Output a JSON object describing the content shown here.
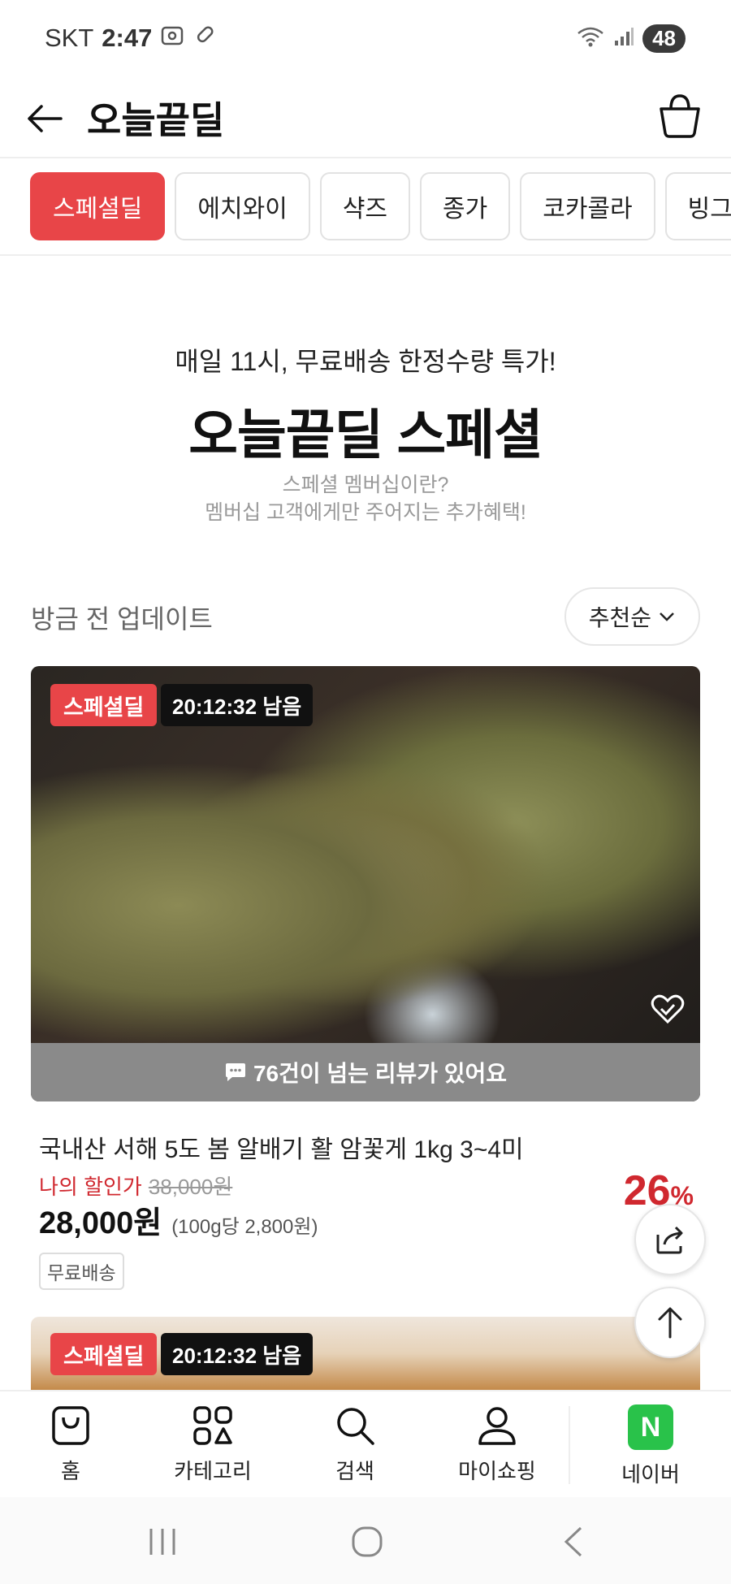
{
  "status_bar": {
    "carrier": "SKT",
    "time": "2:47",
    "battery": "48"
  },
  "header": {
    "title": "오늘끝딜"
  },
  "tabs": [
    {
      "label": "스페셜딜"
    },
    {
      "label": "에치와이"
    },
    {
      "label": "샥즈"
    },
    {
      "label": "종가"
    },
    {
      "label": "코카콜라"
    },
    {
      "label": "빙그레"
    }
  ],
  "banner": {
    "subtitle": "매일 11시, 무료배송 한정수량 특가!",
    "title": "오늘끝딜 스페셜",
    "desc_line1": "스페셜 멤버십이란?",
    "desc_line2": "멤버십 고객에게만 주어지는 추가혜택!"
  },
  "list": {
    "update_label": "방금 전 업데이트",
    "sort_label": "추천순"
  },
  "product": {
    "badge": "스페셜딜",
    "timer": "20:12:32 남음",
    "review_text": "76건이 넘는 리뷰가 있어요",
    "name": "국내산 서해 5도 봄 알배기 활 암꽃게 1kg 3~4미",
    "my_price_label": "나의 할인가",
    "original_price": "38,000원",
    "price": "28,000원",
    "unit_price": "(100g당 2,800원)",
    "discount": "26",
    "discount_unit": "%",
    "shipping": "무료배송"
  },
  "next_product": {
    "badge": "스페셜딜",
    "timer": "20:12:32 남음"
  },
  "bottom_nav": [
    {
      "label": "홈",
      "icon": "shopping-bag-icon"
    },
    {
      "label": "카테고리",
      "icon": "grid-icon"
    },
    {
      "label": "검색",
      "icon": "search-icon"
    },
    {
      "label": "마이쇼핑",
      "icon": "user-icon"
    },
    {
      "label": "네이버",
      "icon": "naver-logo-icon",
      "logo_letter": "N"
    }
  ],
  "colors": {
    "accent": "#e84548",
    "price_red": "#d0282f",
    "naver_green": "#29c24a"
  }
}
